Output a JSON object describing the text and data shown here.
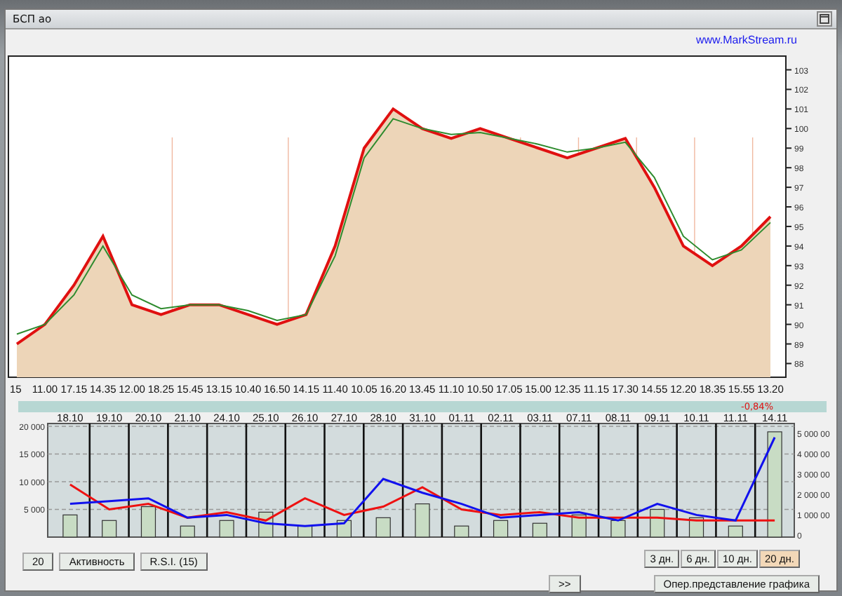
{
  "window": {
    "title": "БСП ао"
  },
  "link": "www.MarkStream.ru",
  "price_chart": {
    "chart_data": {
      "type": "area",
      "categories": [
        "15",
        "11.00",
        "17.15",
        "14.35",
        "12.00",
        "18.25",
        "15.45",
        "13.15",
        "10.40",
        "16.50",
        "14.15",
        "11.40",
        "10.05",
        "16.20",
        "13.45",
        "11.10",
        "10.50",
        "17.05",
        "15.00",
        "12.35",
        "11.15",
        "17.30",
        "14.55",
        "12.20",
        "18.35",
        "15.55",
        "13.20"
      ],
      "series": [
        {
          "color": "#e01010",
          "values": [
            89,
            90,
            92,
            94.5,
            91,
            90.5,
            91,
            91,
            90.5,
            90,
            90.5,
            94,
            99,
            101,
            100,
            99.5,
            100,
            99.5,
            99,
            98.5,
            99,
            99.5,
            97,
            94,
            93,
            94,
            95.5
          ]
        },
        {
          "type": "line",
          "color": "#2e8b2e",
          "values": [
            89.5,
            90,
            91.5,
            94,
            91.5,
            90.8,
            91,
            91,
            90.7,
            90.2,
            90.5,
            93.5,
            98.5,
            100.5,
            100,
            99.7,
            99.8,
            99.5,
            99.2,
            98.8,
            99,
            99.3,
            97.5,
            94.5,
            93.3,
            93.8,
            95.2
          ]
        }
      ],
      "ylim": [
        87.3,
        103.7
      ],
      "yticks": [
        88,
        89,
        90,
        91,
        92,
        93,
        94,
        95,
        96,
        97,
        98,
        99,
        100,
        101,
        102,
        103
      ]
    }
  },
  "change": "-0,84%",
  "activity_chart": {
    "chart_data": {
      "type": "line",
      "categories": [
        "18.10",
        "19.10",
        "20.10",
        "21.10",
        "24.10",
        "25.10",
        "26.10",
        "27.10",
        "28.10",
        "31.10",
        "01.11",
        "02.11",
        "03.11",
        "07.11",
        "08.11",
        "09.11",
        "10.11",
        "11.11",
        "14.11"
      ],
      "series": [
        {
          "type": "bar",
          "color": "#c8dcc4",
          "values": [
            4000,
            3000,
            5500,
            2000,
            3000,
            4500,
            2000,
            3000,
            3500,
            6000,
            2000,
            3000,
            2500,
            4000,
            3000,
            5000,
            3500,
            2000,
            19000
          ]
        },
        {
          "color": "#ee1111",
          "values": [
            9500,
            5000,
            6000,
            3500,
            4500,
            3000,
            7000,
            4000,
            5500,
            9000,
            5000,
            4000,
            4500,
            3500,
            3500,
            3500,
            3000,
            3000,
            3000
          ]
        },
        {
          "color": "#1111ee",
          "values": [
            6000,
            6500,
            7000,
            3500,
            4000,
            2500,
            2000,
            2500,
            10500,
            8000,
            6000,
            3500,
            4000,
            4500,
            3000,
            6000,
            4000,
            3000,
            18000
          ]
        }
      ],
      "ylim": [
        0,
        20500
      ],
      "grid": true,
      "yticks": [
        {
          "value": 5000,
          "label": "5 000"
        },
        {
          "value": 10000,
          "label": "10 000"
        },
        {
          "value": 15000,
          "label": "15 000"
        },
        {
          "value": 20000,
          "label": "20 000"
        }
      ]
    },
    "right_axis_labels": [
      "5 000 00",
      "4 000 00",
      "3 000 00",
      "2 000 00",
      "1 000 00",
      "0"
    ]
  },
  "left_buttons": [
    "20",
    "Активность",
    "R.S.I.  (15)"
  ],
  "days": [
    {
      "label": "3 дн.",
      "selected": false
    },
    {
      "label": "6 дн.",
      "selected": false
    },
    {
      "label": "10 дн.",
      "selected": false
    },
    {
      "label": "20 дн.",
      "selected": true
    }
  ],
  "next_button": ">>",
  "mode_button": "Опер.представление графика"
}
